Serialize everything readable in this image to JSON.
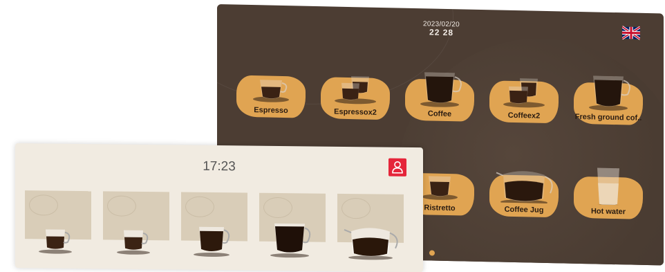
{
  "dark_screen": {
    "date": "2023/02/20",
    "time": "22 28",
    "language_flag": "uk-flag-icon",
    "accent_color": "#e0a452",
    "drinks": [
      {
        "label": "Espresso",
        "icon": "espresso-cup-icon"
      },
      {
        "label": "Espressox2",
        "icon": "double-espresso-cup-icon"
      },
      {
        "label": "Coffee",
        "icon": "coffee-cup-icon"
      },
      {
        "label": "Coffeex2",
        "icon": "double-coffee-cup-icon"
      },
      {
        "label": "Fresh ground cof..",
        "icon": "fresh-ground-coffee-cup-icon"
      },
      {
        "label": "Ristretto",
        "icon": "ristretto-cup-icon"
      },
      {
        "label": "Coffee Jug",
        "icon": "coffee-jug-icon"
      },
      {
        "label": "Hot water",
        "icon": "hot-water-glass-icon"
      }
    ]
  },
  "light_screen": {
    "time": "17:23",
    "user_button_icon": "user-icon",
    "tiles": [
      {
        "icon": "espresso-cup-icon"
      },
      {
        "icon": "espresso-cup-icon"
      },
      {
        "icon": "coffee-cup-icon"
      },
      {
        "icon": "large-coffee-cup-icon"
      },
      {
        "icon": "coffee-jug-icon"
      }
    ]
  }
}
